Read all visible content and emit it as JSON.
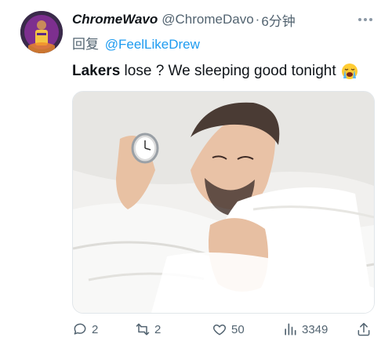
{
  "tweet": {
    "display_name": "ChromeWavo",
    "handle": "@ChromeDavo",
    "separator": "·",
    "time": "6分钟",
    "reply_prefix": "回复",
    "reply_to": "@FeelLikeDrew",
    "text_bold": "Lakers",
    "text_rest": " lose ? We sleeping good tonight",
    "emoji_icon": "loudly-crying-face-icon",
    "media_description_icon": "photo"
  },
  "actions": {
    "replies": "2",
    "retweets": "2",
    "likes": "50",
    "views": "3349"
  },
  "colors": {
    "text": "#0f1419",
    "secondary": "#536471",
    "link": "#1d9bf0"
  }
}
